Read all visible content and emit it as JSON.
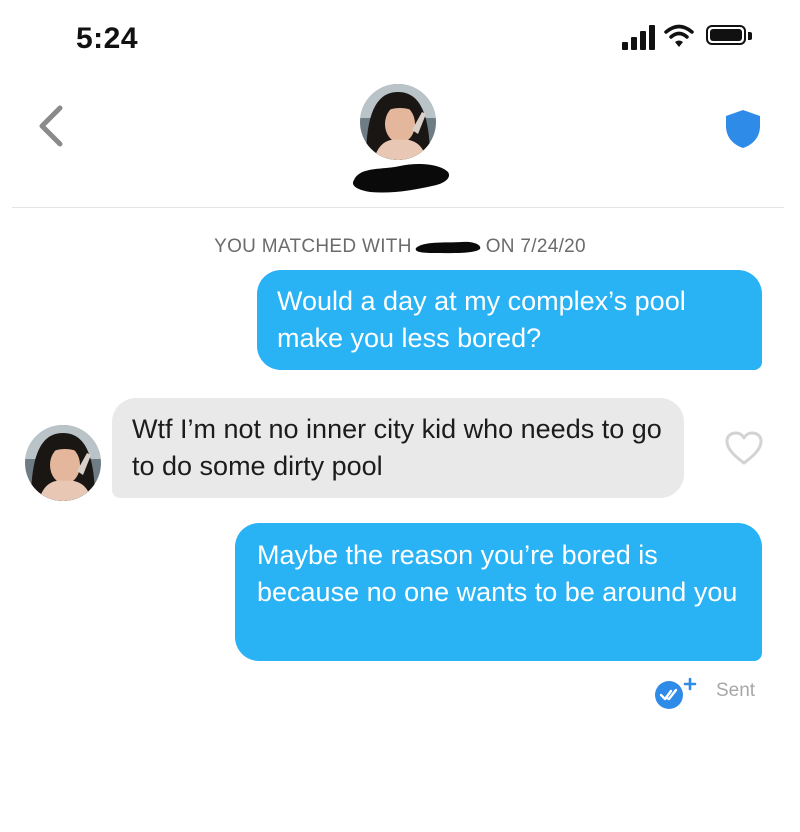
{
  "status_bar": {
    "time": "5:24"
  },
  "header": {
    "back_icon": "chevron-left-icon",
    "safety_icon": "shield-icon",
    "accent": "#2f8be8"
  },
  "match": {
    "prefix": "YOU MATCHED WITH",
    "suffix": "ON 7/24/20"
  },
  "messages": [
    {
      "direction": "outgoing",
      "text": "Would a day at my complex’s pool make you less bored?"
    },
    {
      "direction": "incoming",
      "text": "Wtf I’m not no inner city kid who needs to go to do some dirty pool"
    },
    {
      "direction": "outgoing",
      "text": "Maybe the reason you’re bored is because no one wants to be around you"
    }
  ],
  "receipt": {
    "status": "Sent",
    "icon": "read-receipt-check-icon"
  },
  "colors": {
    "outgoing_bubble": "#29b3f5",
    "incoming_bubble": "#e9e9ea",
    "meta_text": "#6b6b6b"
  }
}
